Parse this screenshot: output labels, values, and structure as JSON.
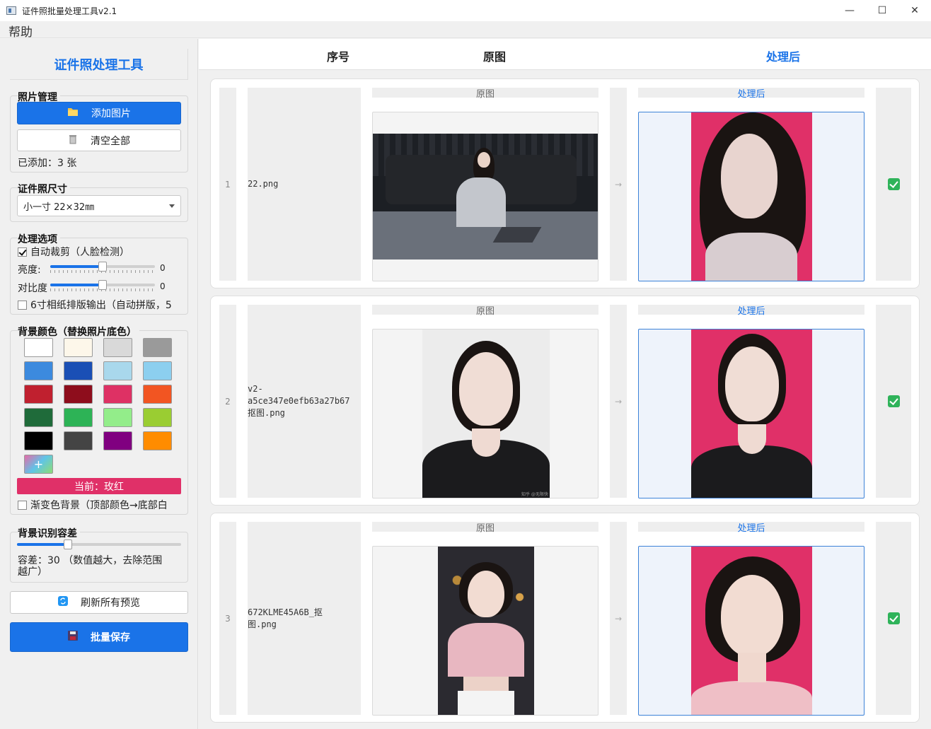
{
  "window": {
    "title": "证件照批量处理工具v2.1",
    "minimize_glyph": "—",
    "maximize_glyph": "☐",
    "close_glyph": "✕"
  },
  "menu": {
    "help": "帮助"
  },
  "sidebar": {
    "title": "证件照处理工具",
    "photo_group": {
      "title": "照片管理",
      "add_label": "添加图片",
      "clear_label": "清空全部",
      "count_text": "已添加：3 张"
    },
    "size_group": {
      "title": "证件照尺寸",
      "selected": "小一寸    22×32㎜"
    },
    "options_group": {
      "title": "处理选项",
      "auto_crop": "自动裁剪（人脸检测）",
      "auto_crop_checked": true,
      "brightness_label": "亮度:",
      "brightness_value": "0",
      "brightness_level": 0.5,
      "contrast_label": "对比度",
      "contrast_value": "0",
      "contrast_level": 0.5,
      "layout_option": "6寸相纸排版输出（自动拼版，5",
      "layout_checked": false
    },
    "bg_group": {
      "title": "背景颜色（替换照片底色）",
      "swatches": [
        "#ffffff",
        "#fdf7ea",
        "#d9d9d9",
        "#9a9a9a",
        "#3c8ade",
        "#1a4fb5",
        "#a9d8ec",
        "#8ccfef",
        "#c0202f",
        "#8e0d1c",
        "#de3164",
        "#f25522",
        "#1f6b3a",
        "#2db356",
        "#93ed8a",
        "#9acd32",
        "#000000",
        "#444444",
        "#800080",
        "#ff8c00"
      ],
      "add_glyph": "+",
      "current_text": "当前：玫红",
      "current_color": "#e03068",
      "gradient_option": "渐变色背景（顶部颜色→底部白",
      "gradient_checked": false
    },
    "tolerance_group": {
      "title": "背景识别容差",
      "level": 0.3,
      "desc_line1": "容差：30   （数值越大，去除范围",
      "desc_line2": "越广）"
    },
    "refresh_label": "刷新所有预览",
    "save_label": "批量保存"
  },
  "table": {
    "headers": {
      "index": "序号",
      "original": "原图",
      "processed": "处理后"
    },
    "original_label": "原图",
    "processed_label": "处理后",
    "arrow": "→",
    "rows": [
      {
        "index": "1",
        "filename": "22.png"
      },
      {
        "index": "2",
        "filename": "v2-\na5ce347e0efb63a27b67\n抠图.png",
        "watermark": "知乎 @无限快乐"
      },
      {
        "index": "3",
        "filename": "672KLME45A6B_抠\n图.png"
      }
    ]
  },
  "colors": {
    "accent": "#1a73e8",
    "rose_red": "#e03068",
    "success": "#2fb35a"
  }
}
